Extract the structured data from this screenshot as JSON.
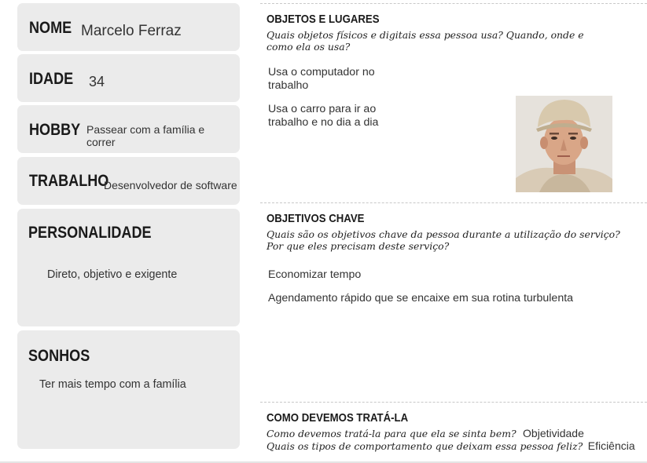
{
  "profile": {
    "name_label": "NOME",
    "name_value": "Marcelo Ferraz",
    "age_label": "IDADE",
    "age_value": "34",
    "hobby_label": "HOBBY",
    "hobby_value": "Passear com a família e correr",
    "job_label": "TRABALHO",
    "job_value": "Desenvolvedor de software",
    "personality_label": "PERSONALIDADE",
    "personality_value": "Direto, objetivo e exigente",
    "dreams_label": "SONHOS",
    "dreams_value": "Ter mais tempo com a família"
  },
  "objects": {
    "title": "OBJETOS E LUGARES",
    "subtitle": "Quais objetos físicos e digitais essa pessoa usa? Quando, onde e como ela os usa?",
    "items": [
      "Usa o computador no trabalho",
      "Usa o carro para ir ao trabalho e no dia a dia"
    ]
  },
  "goals": {
    "title": "OBJETIVOS CHAVE",
    "subtitle": "Quais são os objetivos chave da pessoa durante a utilização do serviço? Por que eles precisam deste serviço?",
    "items": [
      "Economizar tempo",
      "Agendamento rápido que se encaixe em sua rotina turbulenta"
    ]
  },
  "treatment": {
    "title": "COMO DEVEMOS TRATÁ-LA",
    "question1": "Como devemos tratá-la para que ela se sinta bem?",
    "answer1": "Objetividade",
    "question2": "Quais os tipos de comportamento que deixam essa pessoa feliz?",
    "answer2": "Eficiência"
  },
  "colors": {
    "card_bg": "#ebebeb",
    "text": "#333333",
    "heading": "#1a1a1a"
  },
  "photo": {
    "icon": "persona-portrait-photo"
  }
}
